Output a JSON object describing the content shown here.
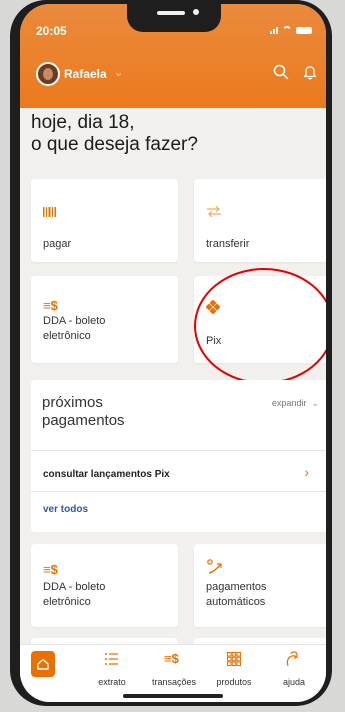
{
  "status_bar": {
    "time": "20:05"
  },
  "header": {
    "user_name": "Rafaela"
  },
  "greeting": "hoje, dia 18,\no que deseja fazer?",
  "quick_actions": [
    {
      "label": "pagar",
      "icon": "barcode-icon"
    },
    {
      "label": "transferir",
      "icon": "transfer-arrows-icon"
    },
    {
      "label": "DDA - boleto\neletrônico",
      "icon": "dda-money-icon"
    },
    {
      "label": "Pix",
      "icon": "pix-icon"
    }
  ],
  "upcoming": {
    "title": "próximos\npagamentos",
    "expand_label": "expandir",
    "consult_label": "consultar lançamentos Pix",
    "see_all_label": "ver todos"
  },
  "more_actions": [
    {
      "label": "DDA - boleto\neletrônico",
      "icon": "dda-money-icon"
    },
    {
      "label": "pagamentos\nautomáticos",
      "icon": "auto-payment-icon"
    }
  ],
  "tabbar": {
    "items": [
      {
        "label": "",
        "icon": "home-icon"
      },
      {
        "label": "extrato",
        "icon": "statement-icon"
      },
      {
        "label": "transações",
        "icon": "transactions-icon"
      },
      {
        "label": "produtos",
        "icon": "products-icon"
      },
      {
        "label": "ajuda",
        "icon": "help-icon"
      }
    ]
  },
  "colors": {
    "brand_orange": "#ec7000",
    "link_blue": "#2e59a7",
    "annotation_red": "#e40000"
  }
}
